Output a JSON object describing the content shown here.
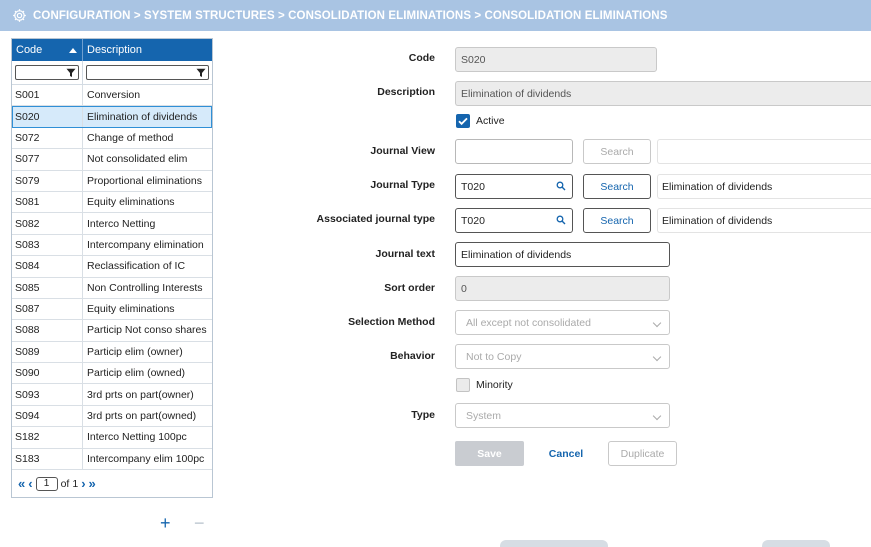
{
  "header": {
    "breadcrumb": "CONFIGURATION > SYSTEM STRUCTURES > CONSOLIDATION ELIMINATIONS > CONSOLIDATION ELIMINATIONS",
    "icon": "gear-icon"
  },
  "grid": {
    "columns": [
      "Code",
      "Description"
    ],
    "sort_column": "Code",
    "sort_direction": "ascending",
    "selected_code": "S020",
    "rows": [
      {
        "code": "S001",
        "description": "Conversion"
      },
      {
        "code": "S020",
        "description": "Elimination of dividends"
      },
      {
        "code": "S072",
        "description": "Change of method"
      },
      {
        "code": "S077",
        "description": "Not consolidated elim"
      },
      {
        "code": "S079",
        "description": "Proportional eliminations"
      },
      {
        "code": "S081",
        "description": "Equity eliminations"
      },
      {
        "code": "S082",
        "description": "Interco Netting"
      },
      {
        "code": "S083",
        "description": "Intercompany elimination"
      },
      {
        "code": "S084",
        "description": "Reclassification of IC"
      },
      {
        "code": "S085",
        "description": "Non Controlling Interests"
      },
      {
        "code": "S087",
        "description": "Equity eliminations"
      },
      {
        "code": "S088",
        "description": "Particip Not conso shares"
      },
      {
        "code": "S089",
        "description": "Particip elim (owner)"
      },
      {
        "code": "S090",
        "description": "Particip elim (owned)"
      },
      {
        "code": "S093",
        "description": "3rd prts on part(owner)"
      },
      {
        "code": "S094",
        "description": "3rd prts on part(owned)"
      },
      {
        "code": "S182",
        "description": "Interco Netting 100pc"
      },
      {
        "code": "S183",
        "description": "Intercompany elim 100pc"
      }
    ],
    "pager": {
      "current_page": "1",
      "of_label": "of",
      "total_pages": "1"
    }
  },
  "list_actions": {
    "add": "+",
    "remove": "−"
  },
  "form": {
    "code": {
      "label": "Code",
      "value": "S020"
    },
    "description": {
      "label": "Description",
      "value": "Elimination of dividends"
    },
    "active": {
      "label": "Active",
      "checked": true
    },
    "journal_view": {
      "label": "Journal View",
      "value": "",
      "search_label": "Search"
    },
    "journal_type": {
      "label": "Journal Type",
      "value": "T020",
      "search_label": "Search",
      "resolved": "Elimination of dividends"
    },
    "associated_journal_type": {
      "label": "Associated journal type",
      "value": "T020",
      "search_label": "Search",
      "resolved": "Elimination of dividends"
    },
    "journal_text": {
      "label": "Journal text",
      "value": "Elimination of dividends"
    },
    "sort_order": {
      "label": "Sort order",
      "value": "0"
    },
    "selection_method": {
      "label": "Selection Method",
      "value": "All except not consolidated"
    },
    "behavior": {
      "label": "Behavior",
      "value": "Not to Copy"
    },
    "minority": {
      "label": "Minority",
      "checked": false
    },
    "type": {
      "label": "Type",
      "value": "System"
    }
  },
  "actions": {
    "save": "Save",
    "cancel": "Cancel",
    "duplicate": "Duplicate"
  },
  "colors": {
    "accent": "#1565ae",
    "header_bg": "#a9c4e3",
    "selected_row": "#d6eafa"
  }
}
